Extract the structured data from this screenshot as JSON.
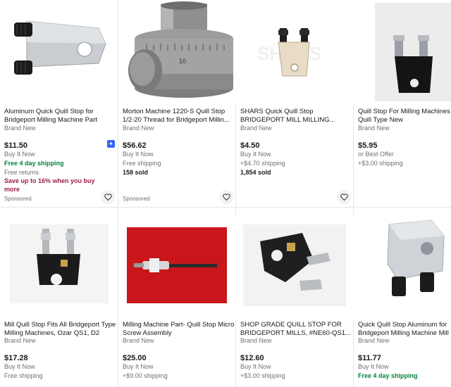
{
  "listings": [
    {
      "title": "Aluminum Quick Quill Stop for Bridgeport Milling Machine Part",
      "condition": "Brand New",
      "price": "$11.50",
      "line1": "Buy It Now",
      "line2": "Free 4 day shipping",
      "line3": "Free returns",
      "promo": "Save up to 16% when you buy more",
      "sponsored": "Sponsored"
    },
    {
      "title": "Morton Machine 1220-S Quill Stop 1/2-20 Thread for Bridgeport Millin...",
      "condition": "Brand New",
      "price": "$56.62",
      "line1": "Buy It Now",
      "line2": "Free shipping",
      "line3": "158 sold",
      "sponsored": "Sponsored",
      "dial_text": "10"
    },
    {
      "title": "SHARS Quick Quill Stop BRIDGEPORT MILL MILLING...",
      "condition": "Brand New",
      "price": "$4.50",
      "line1": "Buy It Now",
      "line2": "+$4.70 shipping",
      "line3": "1,854 sold",
      "watermark": "SHARS"
    },
    {
      "title": "Quill Stop For Milling Machines Rapid Quill Type New",
      "condition": "Brand New",
      "price": "$5.95",
      "line1": "or Best Offer",
      "line2": "+$3.00 shipping"
    },
    {
      "title": "Mill Quill Stop Fits All Bridgeport Type Milling Machines, Ozar QS1, D2",
      "condition": "Brand New",
      "price": "$17.28",
      "line1": "Buy It Now",
      "line2": "Free shipping"
    },
    {
      "title": "Milling Machine Part- Quill Stop Micro Screw Assembly",
      "condition": "Brand New",
      "price": "$25.00",
      "line1": "Buy It Now",
      "line2": "+$9.00 shipping"
    },
    {
      "title": "SHOP GRADE QUILL STOP FOR BRIDGEPORT MILLS, #NE60-QS1...",
      "condition": "Brand New",
      "price": "$12.60",
      "line1": "Buy It Now",
      "line2": "+$3.00 shipping"
    },
    {
      "title": "Quick Quill Stop Aluminum for Bridgeport Milling Machine Mill",
      "condition": "Brand New",
      "price": "$11.77",
      "line1": "Buy It Now",
      "line2": "Free 4 day shipping"
    }
  ],
  "colors": {
    "green_shipping": "#05823f",
    "promo": "#9b1f45",
    "muted_text": "#707070",
    "badge": "#3665f3"
  },
  "icons": {
    "watch": "heart-icon",
    "authenticity": "authenticity-badge-icon"
  }
}
